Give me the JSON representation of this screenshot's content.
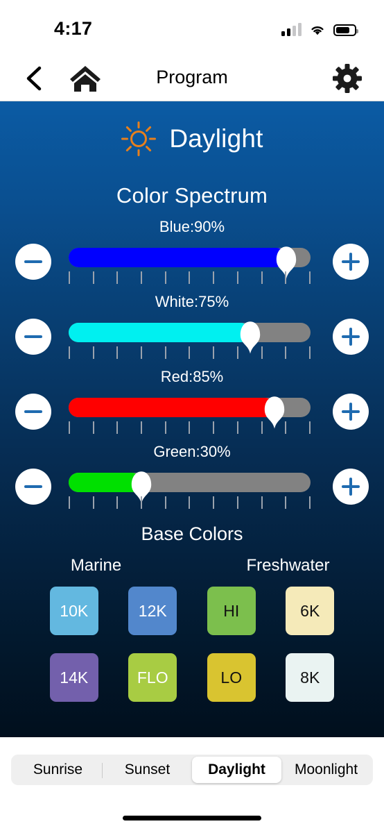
{
  "status_bar": {
    "time": "4:17",
    "signal_icon": "cellular-signal-icon",
    "wifi_icon": "wifi-icon",
    "battery_icon": "battery-icon"
  },
  "nav_bar": {
    "back_icon": "chevron-left-icon",
    "home_icon": "home-icon",
    "title": "Program",
    "settings_icon": "gear-icon"
  },
  "mode_header": {
    "icon": "sun-icon",
    "icon_color": "#E8801C",
    "name": "Daylight"
  },
  "spectrum": {
    "title": "Color Spectrum",
    "decrement_label": "−",
    "increment_label": "+",
    "tick_count": 11,
    "channels": [
      {
        "name": "Blue",
        "value": 90,
        "label": "Blue:90%",
        "color": "#0000FF"
      },
      {
        "name": "White",
        "value": 75,
        "label": "White:75%",
        "color": "#00F0F0"
      },
      {
        "name": "Red",
        "value": 85,
        "label": "Red:85%",
        "color": "#FF0000"
      },
      {
        "name": "Green",
        "value": 30,
        "label": "Green:30%",
        "color": "#00E000"
      }
    ],
    "track_color": "#828282",
    "thumb_color": "#FFFFFF"
  },
  "base_colors": {
    "title": "Base Colors",
    "groups": [
      {
        "name": "Marine"
      },
      {
        "name": "Freshwater"
      }
    ],
    "swatches": [
      {
        "label": "10K",
        "bg": "#63B8E0",
        "fg": "#FFFFFF"
      },
      {
        "label": "12K",
        "bg": "#5287CC",
        "fg": "#FFFFFF"
      },
      {
        "label": "HI",
        "bg": "#7CBF4D",
        "fg": "#111111"
      },
      {
        "label": "6K",
        "bg": "#F5EAB9",
        "fg": "#111111"
      },
      {
        "label": "14K",
        "bg": "#7360AC",
        "fg": "#FFFFFF"
      },
      {
        "label": "FLO",
        "bg": "#A8CC43",
        "fg": "#FFFFFF"
      },
      {
        "label": "LO",
        "bg": "#D9C430",
        "fg": "#111111"
      },
      {
        "label": "8K",
        "bg": "#EAF3F2",
        "fg": "#111111"
      }
    ]
  },
  "tab_bar": {
    "items": [
      {
        "label": "Sunrise",
        "active": false
      },
      {
        "label": "Sunset",
        "active": false
      },
      {
        "label": "Daylight",
        "active": true
      },
      {
        "label": "Moonlight",
        "active": false
      }
    ]
  }
}
